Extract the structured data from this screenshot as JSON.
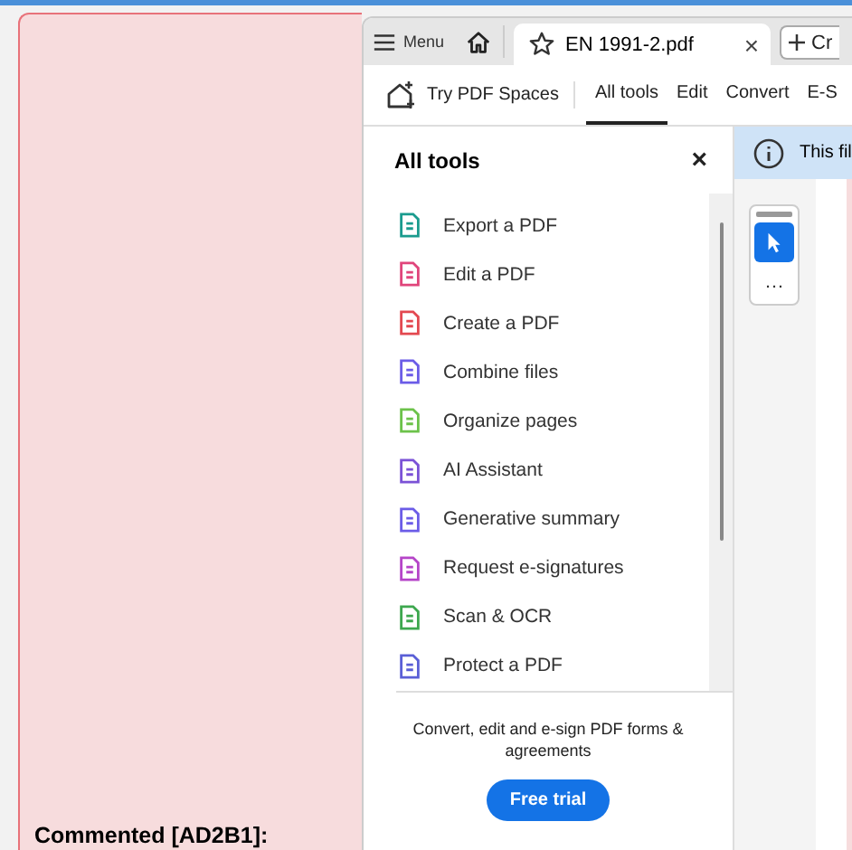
{
  "document": {
    "comment_label": "Commented [AD2B1]:"
  },
  "browser_tabs": {
    "menu": "Menu",
    "tabs": [
      {
        "label": "EN 1991-2.pdf",
        "selected": true,
        "close": "×"
      }
    ],
    "create": "Cr"
  },
  "toolbar": {
    "spaces": "Try PDF Spaces",
    "tabs": [
      {
        "label": "All tools",
        "selected": true
      },
      {
        "label": "Edit",
        "selected": false
      },
      {
        "label": "Convert",
        "selected": false
      },
      {
        "label": "E-S",
        "selected": false
      }
    ]
  },
  "tools_panel": {
    "title": "All tools",
    "close": "×",
    "items": [
      {
        "label": "Export a PDF",
        "color": "#1a9b8e"
      },
      {
        "label": "Edit a PDF",
        "color": "#e0457b"
      },
      {
        "label": "Create a PDF",
        "color": "#e34850"
      },
      {
        "label": "Combine files",
        "color": "#6b5ce7"
      },
      {
        "label": "Organize pages",
        "color": "#6cc24a"
      },
      {
        "label": "AI Assistant",
        "color": "#7b52d6"
      },
      {
        "label": "Generative summary",
        "color": "#6b5ce7"
      },
      {
        "label": "Request e-signatures",
        "color": "#b545c8"
      },
      {
        "label": "Scan & OCR",
        "color": "#3da74e"
      },
      {
        "label": "Protect a PDF",
        "color": "#5a5fd6"
      }
    ],
    "promo": "Convert, edit and e-sign PDF forms & agreements",
    "button": "Free trial"
  },
  "info_bar": {
    "text": "This fil"
  },
  "quick_tools": {
    "more": "…"
  }
}
